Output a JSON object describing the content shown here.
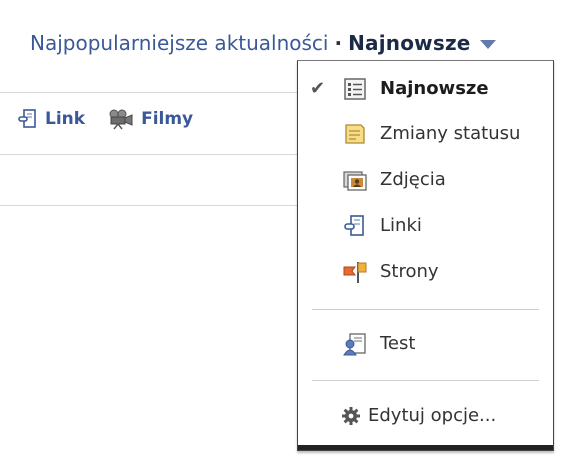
{
  "header": {
    "top_link": "Najpopularniejsze aktualności",
    "separator": "·",
    "current": "Najnowsze"
  },
  "composer": {
    "items": [
      {
        "label": "Link",
        "icon": "link-icon"
      },
      {
        "label": "Filmy",
        "icon": "video-camera-icon"
      }
    ]
  },
  "menu": {
    "check_mark": "✔",
    "items": [
      {
        "label": "Najnowsze",
        "icon": "news-feed-icon",
        "selected": true
      },
      {
        "label": "Zmiany statusu",
        "icon": "status-note-icon"
      },
      {
        "label": "Zdjęcia",
        "icon": "photos-icon"
      },
      {
        "label": "Linki",
        "icon": "link-icon"
      },
      {
        "label": "Strony",
        "icon": "pages-flag-icon"
      }
    ],
    "lists": [
      {
        "label": "Test",
        "icon": "friend-list-icon"
      }
    ],
    "edit_label": "Edytuj opcje...",
    "edit_icon": "gear-icon"
  },
  "colors": {
    "link_blue": "#3b5998",
    "caret": "#627aad",
    "menu_border": "#444444"
  }
}
